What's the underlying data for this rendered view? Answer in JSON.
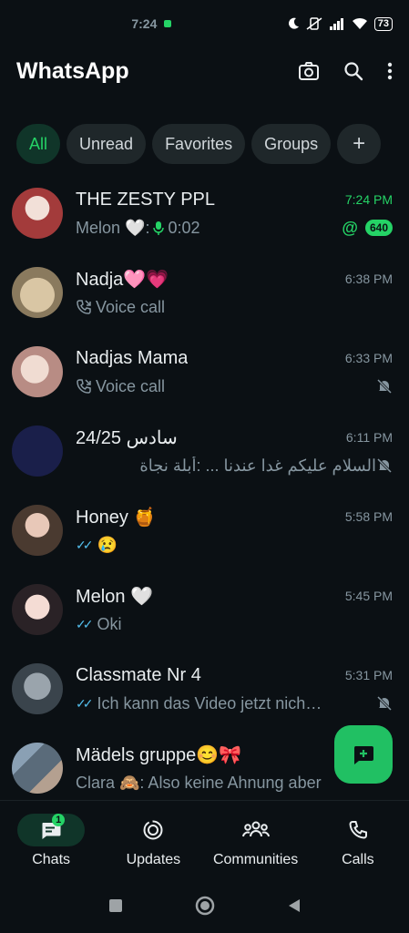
{
  "status_bar": {
    "time": "7:24",
    "battery": "73",
    "icons": [
      "moon-icon",
      "mute-vibrate-icon",
      "signal-icon",
      "wifi-icon",
      "battery-icon"
    ]
  },
  "header": {
    "title": "WhatsApp",
    "icons": [
      "camera-icon",
      "search-icon",
      "more-vert-icon"
    ]
  },
  "filters": [
    {
      "label": "All",
      "active": true
    },
    {
      "label": "Unread"
    },
    {
      "label": "Favorites"
    },
    {
      "label": "Groups"
    },
    {
      "label": "+"
    }
  ],
  "chats": [
    {
      "name": "THE ZESTY PPL",
      "time": "7:24 PM",
      "time_unread": true,
      "sender": "Melon 🤍:",
      "preview": "0:02",
      "mention": "@",
      "badge": "640",
      "avatar_color": "#a33b3b"
    },
    {
      "name": "Nadja🩷💗",
      "time": "6:38 PM",
      "preview": "Voice call",
      "icon": "voice-call-icon",
      "avatar_color": "#c9b08a"
    },
    {
      "name": "Nadjas Mama",
      "time": "6:33 PM",
      "preview": "Voice call",
      "icon": "voice-call-icon",
      "muted": true,
      "avatar_color": "#d6b6a8"
    },
    {
      "name": "24/25 سادس",
      "time": "6:11 PM",
      "preview": "السلام عليكم غدا عندنا ... :أبلة نجاة",
      "muted": true,
      "avatar_color": "#1a1f4a"
    },
    {
      "name": "Honey 🍯",
      "time": "5:58 PM",
      "preview": "😢",
      "ticks": true,
      "avatar_color": "#8a6a5a"
    },
    {
      "name": "Melon 🤍",
      "time": "5:45 PM",
      "preview": "Oki",
      "ticks": true,
      "avatar_color": "#e0c4c4"
    },
    {
      "name": "Classmate Nr 4",
      "time": "5:31 PM",
      "preview": "Ich kann das Video jetzt nich…",
      "ticks": true,
      "muted": true,
      "avatar_color": "#5a6670"
    },
    {
      "name": "Mädels gruppe😊🎀",
      "time": "",
      "preview": "Clara 🙈: Also keine Ahnung aber",
      "avatar_color": "#6a7d8e"
    }
  ],
  "bottom_nav": [
    {
      "label": "Chats",
      "icon": "chats-icon",
      "badge": "1",
      "active": true
    },
    {
      "label": "Updates",
      "icon": "updates-icon"
    },
    {
      "label": "Communities",
      "icon": "communities-icon"
    },
    {
      "label": "Calls",
      "icon": "calls-icon"
    }
  ],
  "colors": {
    "accent": "#25d366",
    "background": "#0b1014",
    "chip": "#1f272a",
    "active_chip": "#103529"
  }
}
